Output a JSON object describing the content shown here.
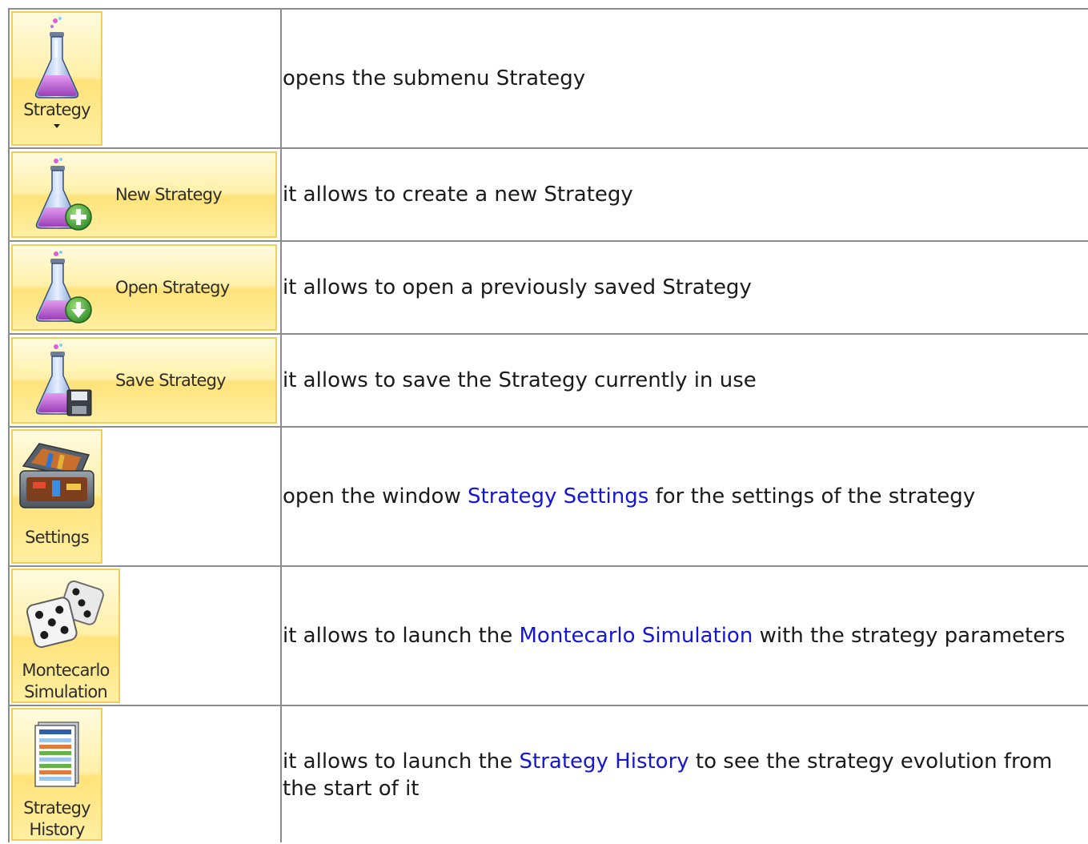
{
  "rows": [
    {
      "button": {
        "label": "Strategy",
        "icon": "flask-icon",
        "has_dropdown": true
      },
      "description": {
        "text_before": "opens the submenu Strategy",
        "link": "",
        "text_after": ""
      }
    },
    {
      "button": {
        "label": "New Strategy",
        "icon": "flask-add-icon"
      },
      "description": {
        "text_before": "it allows to create a new Strategy",
        "link": "",
        "text_after": ""
      }
    },
    {
      "button": {
        "label": "Open Strategy",
        "icon": "flask-open-icon"
      },
      "description": {
        "text_before": "it allows to open a previously saved Strategy",
        "link": "",
        "text_after": ""
      }
    },
    {
      "button": {
        "label": "Save Strategy",
        "icon": "flask-save-icon"
      },
      "description": {
        "text_before": "it allows to save the Strategy currently in use",
        "link": "",
        "text_after": ""
      }
    },
    {
      "button": {
        "label": "Settings",
        "icon": "toolbox-icon"
      },
      "description": {
        "text_before": "open the window ",
        "link": "Strategy Settings",
        "text_after": " for the settings of the strategy"
      }
    },
    {
      "button": {
        "label_line1": "Montecarlo",
        "label_line2": "Simulation",
        "icon": "dice-icon"
      },
      "description": {
        "text_before": "it allows to launch the ",
        "link": "Montecarlo Simulation",
        "text_after": " with the strategy parameters"
      }
    },
    {
      "button": {
        "label_line1": "Strategy",
        "label_line2": "History",
        "icon": "history-report-icon"
      },
      "description": {
        "text_before": "it allows to launch the ",
        "link": "Strategy History",
        "text_after": " to see the strategy evolution from the start of it"
      }
    }
  ],
  "colors": {
    "link": "#1515d6",
    "button_border": "#f0cf58",
    "button_fill": "#ffe37a",
    "table_border": "#8c8c8c"
  }
}
